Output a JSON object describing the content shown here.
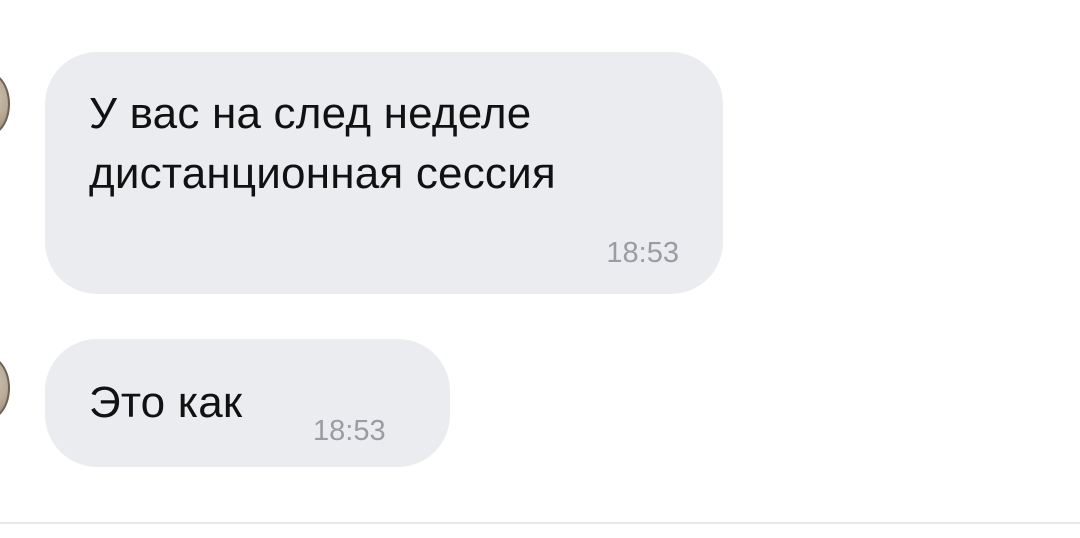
{
  "messages": [
    {
      "line1": "У вас на след неделе",
      "line2": "дистанционная сессия",
      "time": "18:53"
    },
    {
      "text": "Это как",
      "time": "18:53"
    }
  ],
  "colors": {
    "background": "#ffffff",
    "bubble": "#ebecf0",
    "text": "#111111",
    "time": "#9a9ca3",
    "divider": "#e6e7ea"
  },
  "icons": {
    "avatar": "avatar"
  }
}
